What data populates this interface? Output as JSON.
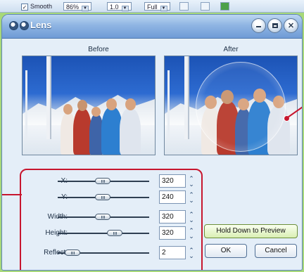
{
  "toolbar": {
    "smooth_label": "Smooth",
    "zoom_value": "86%",
    "ratio_value": "1.0",
    "fit_value": "Full"
  },
  "dialog": {
    "title": "Lens",
    "before_label": "Before",
    "after_label": "After"
  },
  "controls": {
    "x": {
      "label": "X:",
      "value": "320"
    },
    "y": {
      "label": "Y:",
      "value": "240"
    },
    "width": {
      "label": "Width:",
      "value": "320"
    },
    "height": {
      "label": "Height:",
      "value": "320"
    },
    "reflect": {
      "label": "Reflect:",
      "value": "2"
    }
  },
  "buttons": {
    "preview": "Hold Down to Preview",
    "ok": "OK",
    "cancel": "Cancel"
  },
  "colors": {
    "accent_callout": "#c7162e",
    "dialog_bg": "#e4eef8",
    "titlebar": "#6f9bd6",
    "outside_bg": "#a7d879"
  },
  "icons": {
    "title_left": [
      "pin-icon",
      "chevron-icon"
    ],
    "title_right": [
      "minimize-icon",
      "maximize-icon",
      "close-icon"
    ]
  }
}
